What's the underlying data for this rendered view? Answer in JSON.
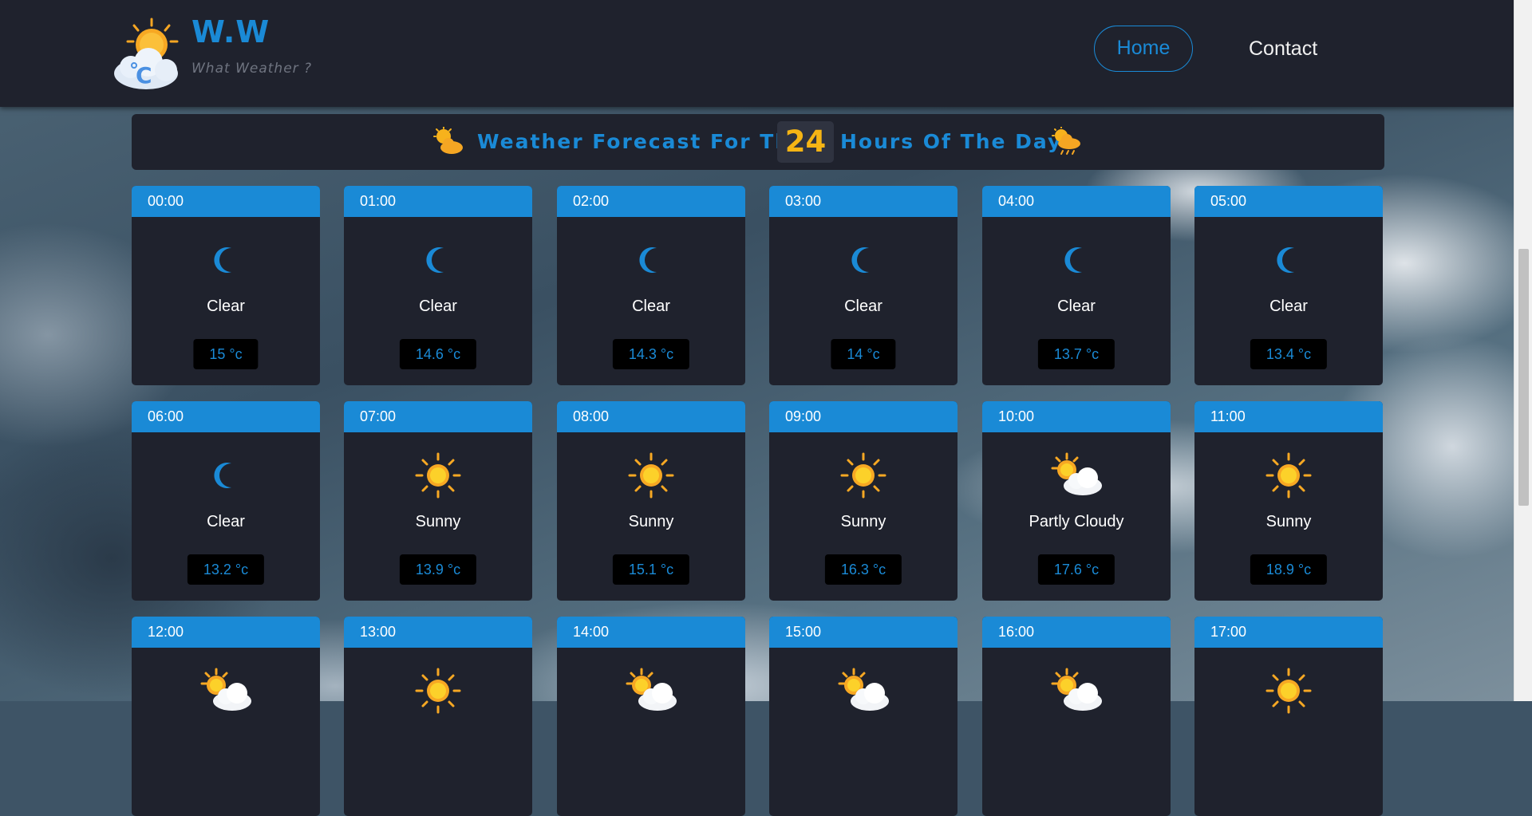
{
  "brand": {
    "title": "W.W",
    "subtitle": "What Weather ?",
    "logo_icon": "sun-cloud-celsius-logo"
  },
  "nav": {
    "home_label": "Home",
    "contact_label": "Contact"
  },
  "banner": {
    "text_before": "Weather Forecast For The",
    "hours": "24",
    "text_after": "Hours Of The Day",
    "left_icon": "sun-cloud-icon",
    "right_icon": "sun-rain-cloud-icon"
  },
  "colors": {
    "accent": "#1a8ad6",
    "card_bg": "#1f222d",
    "header_bg": "#1f222d",
    "highlight": "#f5b414"
  },
  "hours": [
    {
      "time": "00:00",
      "condition": "Clear",
      "temp": "15 °c",
      "icon": "moon-icon"
    },
    {
      "time": "01:00",
      "condition": "Clear",
      "temp": "14.6 °c",
      "icon": "moon-icon"
    },
    {
      "time": "02:00",
      "condition": "Clear",
      "temp": "14.3 °c",
      "icon": "moon-icon"
    },
    {
      "time": "03:00",
      "condition": "Clear",
      "temp": "14 °c",
      "icon": "moon-icon"
    },
    {
      "time": "04:00",
      "condition": "Clear",
      "temp": "13.7 °c",
      "icon": "moon-icon"
    },
    {
      "time": "05:00",
      "condition": "Clear",
      "temp": "13.4 °c",
      "icon": "moon-icon"
    },
    {
      "time": "06:00",
      "condition": "Clear",
      "temp": "13.2 °c",
      "icon": "moon-icon"
    },
    {
      "time": "07:00",
      "condition": "Sunny",
      "temp": "13.9 °c",
      "icon": "sun-icon"
    },
    {
      "time": "08:00",
      "condition": "Sunny",
      "temp": "15.1 °c",
      "icon": "sun-icon"
    },
    {
      "time": "09:00",
      "condition": "Sunny",
      "temp": "16.3 °c",
      "icon": "sun-icon"
    },
    {
      "time": "10:00",
      "condition": "Partly Cloudy",
      "temp": "17.6 °c",
      "icon": "partly-cloudy-icon"
    },
    {
      "time": "11:00",
      "condition": "Sunny",
      "temp": "18.9 °c",
      "icon": "sun-icon"
    },
    {
      "time": "12:00",
      "condition": "",
      "temp": "",
      "icon": "partly-cloudy-icon"
    },
    {
      "time": "13:00",
      "condition": "",
      "temp": "",
      "icon": "sun-icon"
    },
    {
      "time": "14:00",
      "condition": "",
      "temp": "",
      "icon": "partly-cloudy-icon"
    },
    {
      "time": "15:00",
      "condition": "",
      "temp": "",
      "icon": "partly-cloudy-icon"
    },
    {
      "time": "16:00",
      "condition": "",
      "temp": "",
      "icon": "partly-cloudy-icon"
    },
    {
      "time": "17:00",
      "condition": "",
      "temp": "",
      "icon": "sun-icon"
    }
  ]
}
